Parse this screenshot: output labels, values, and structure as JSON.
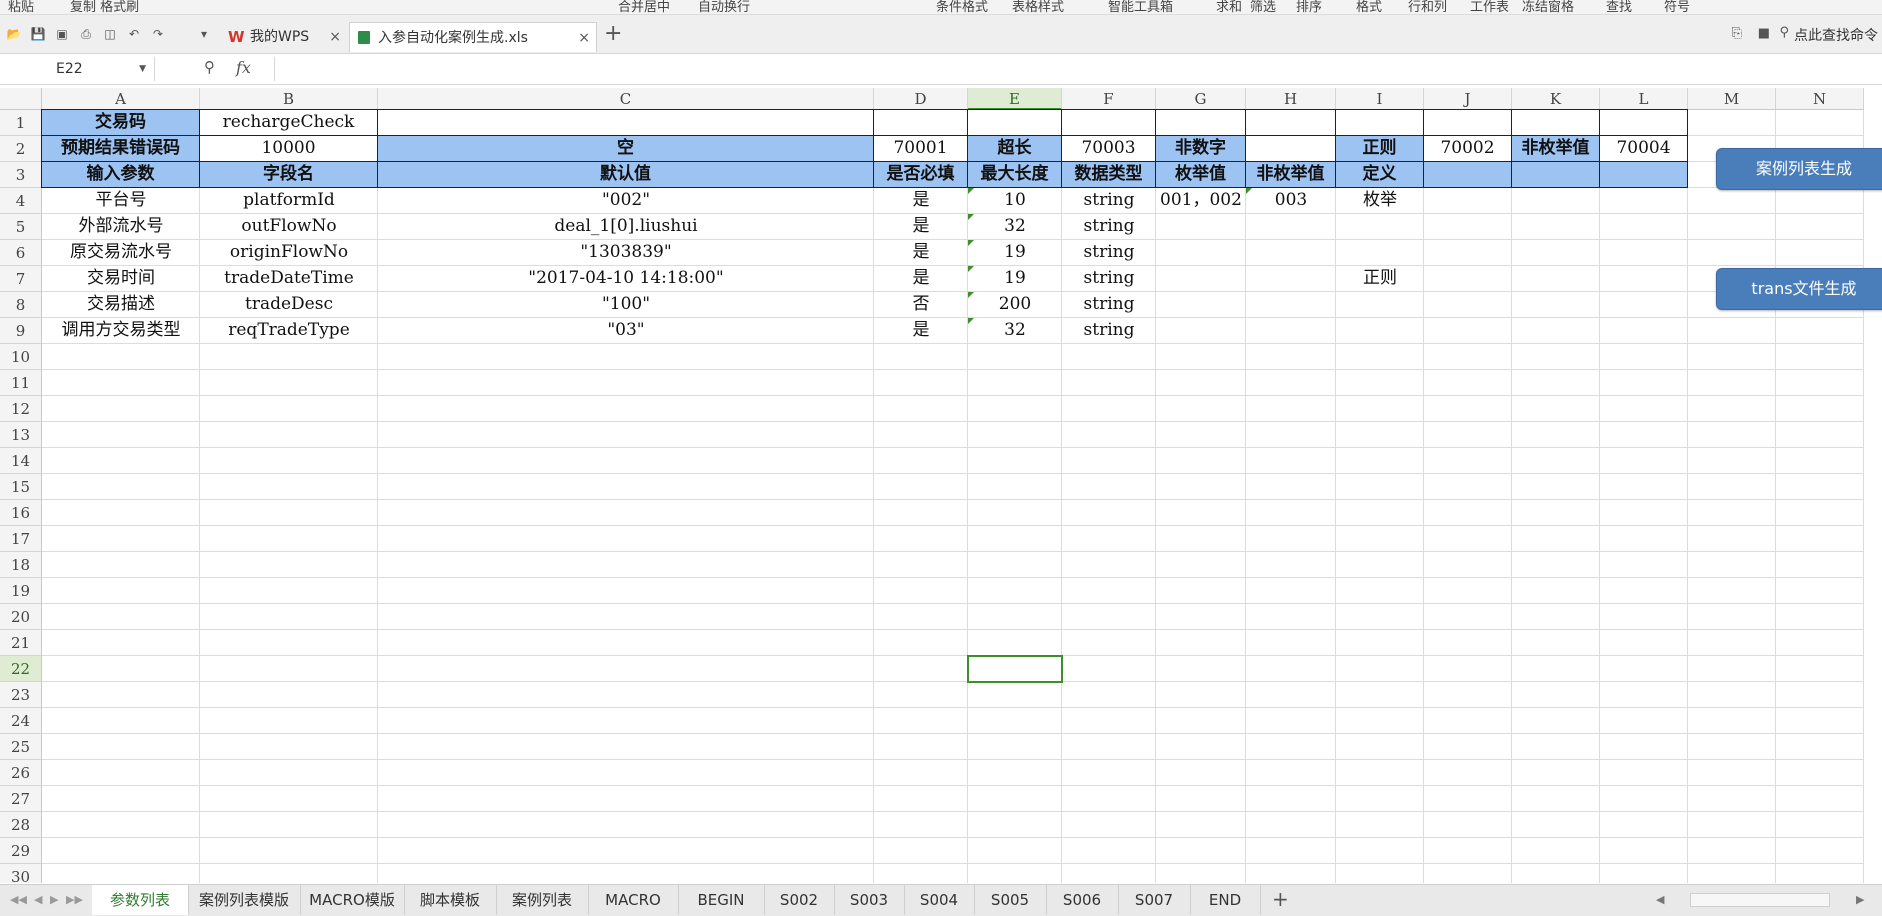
{
  "ribbon": {
    "fragments": [
      "粘贴",
      "复制 格式刷",
      "合并居中",
      "自动换行",
      "条件格式",
      "表格样式",
      "智能工具箱",
      "求和",
      "筛选",
      "排序",
      "格式",
      "行和列",
      "工作表",
      "冻结窗格",
      "查找",
      "符号"
    ]
  },
  "tabs": {
    "items": [
      {
        "label": "我的WPS",
        "active": false
      },
      {
        "label": "入参自动化案例生成.xls",
        "active": true
      }
    ],
    "add_label": "+"
  },
  "toolbar_right": {
    "search_label": "点此查找命令"
  },
  "formula_bar": {
    "cell_ref": "E22",
    "fx_label": "fx",
    "formula": ""
  },
  "columns": [
    "A",
    "B",
    "C",
    "D",
    "E",
    "F",
    "G",
    "H",
    "I",
    "J",
    "K",
    "L",
    "M",
    "N"
  ],
  "selected_column": "E",
  "row_numbers": [
    "1",
    "2",
    "3",
    "4",
    "5",
    "6",
    "7",
    "8",
    "9",
    "10",
    "11",
    "12",
    "13",
    "14",
    "15",
    "16",
    "17",
    "18",
    "19",
    "20",
    "21",
    "22",
    "23",
    "24",
    "25",
    "26",
    "27",
    "28",
    "29",
    "30"
  ],
  "selected_row": "22",
  "cells": [
    {
      "text": "交易码",
      "col": 0,
      "row": 0,
      "style": "blue"
    },
    {
      "text": "rechargeCheck",
      "col": 1,
      "row": 0,
      "style": "bordered"
    },
    {
      "text": "",
      "col": 2,
      "row": 0,
      "style": "bordered"
    },
    {
      "text": "",
      "col": 3,
      "row": 0,
      "style": "bordered"
    },
    {
      "text": "",
      "col": 4,
      "row": 0,
      "style": "bordered"
    },
    {
      "text": "",
      "col": 5,
      "row": 0,
      "style": "bordered"
    },
    {
      "text": "",
      "col": 6,
      "row": 0,
      "style": "bordered"
    },
    {
      "text": "",
      "col": 7,
      "row": 0,
      "style": "bordered"
    },
    {
      "text": "",
      "col": 8,
      "row": 0,
      "style": "bordered"
    },
    {
      "text": "",
      "col": 9,
      "row": 0,
      "style": "bordered"
    },
    {
      "text": "",
      "col": 10,
      "row": 0,
      "style": "bordered"
    },
    {
      "text": "",
      "col": 11,
      "row": 0,
      "style": "bordered"
    },
    {
      "text": "预期结果错误码",
      "col": 0,
      "row": 1,
      "style": "blue"
    },
    {
      "text": "10000",
      "col": 1,
      "row": 1,
      "style": "bordered"
    },
    {
      "text": "空",
      "col": 2,
      "row": 1,
      "style": "blue"
    },
    {
      "text": "70001",
      "col": 3,
      "row": 1,
      "style": "bordered"
    },
    {
      "text": "超长",
      "col": 4,
      "row": 1,
      "style": "blue"
    },
    {
      "text": "70003",
      "col": 5,
      "row": 1,
      "style": "bordered"
    },
    {
      "text": "非数字",
      "col": 6,
      "row": 1,
      "style": "blue"
    },
    {
      "text": "",
      "col": 7,
      "row": 1,
      "style": "bordered"
    },
    {
      "text": "正则",
      "col": 8,
      "row": 1,
      "style": "blue"
    },
    {
      "text": "70002",
      "col": 9,
      "row": 1,
      "style": "bordered"
    },
    {
      "text": "非枚举值",
      "col": 10,
      "row": 1,
      "style": "blue"
    },
    {
      "text": "70004",
      "col": 11,
      "row": 1,
      "style": "bordered"
    },
    {
      "text": "输入参数",
      "col": 0,
      "row": 2,
      "style": "blue"
    },
    {
      "text": "字段名",
      "col": 1,
      "row": 2,
      "style": "blue"
    },
    {
      "text": "默认值",
      "col": 2,
      "row": 2,
      "style": "blue"
    },
    {
      "text": "是否必填",
      "col": 3,
      "row": 2,
      "style": "blue"
    },
    {
      "text": "最大长度",
      "col": 4,
      "row": 2,
      "style": "blue"
    },
    {
      "text": "数据类型",
      "col": 5,
      "row": 2,
      "style": "blue"
    },
    {
      "text": "枚举值",
      "col": 6,
      "row": 2,
      "style": "blue"
    },
    {
      "text": "非枚举值",
      "col": 7,
      "row": 2,
      "style": "blue"
    },
    {
      "text": "定义",
      "col": 8,
      "row": 2,
      "style": "blue"
    },
    {
      "text": "",
      "col": 9,
      "row": 2,
      "style": "blue"
    },
    {
      "text": "",
      "col": 10,
      "row": 2,
      "style": "blue"
    },
    {
      "text": "",
      "col": 11,
      "row": 2,
      "style": "blue"
    },
    {
      "text": "平台号",
      "col": 0,
      "row": 3,
      "style": "plain"
    },
    {
      "text": "platformId",
      "col": 1,
      "row": 3,
      "style": "plain"
    },
    {
      "text": "\"002\"",
      "col": 2,
      "row": 3,
      "style": "plain"
    },
    {
      "text": "是",
      "col": 3,
      "row": 3,
      "style": "plain"
    },
    {
      "text": "10",
      "col": 4,
      "row": 3,
      "style": "tri"
    },
    {
      "text": "string",
      "col": 5,
      "row": 3,
      "style": "plain"
    },
    {
      "text": "001，002",
      "col": 6,
      "row": 3,
      "style": "plain"
    },
    {
      "text": "003",
      "col": 7,
      "row": 3,
      "style": "tri"
    },
    {
      "text": "枚举",
      "col": 8,
      "row": 3,
      "style": "plain"
    },
    {
      "text": "外部流水号",
      "col": 0,
      "row": 4,
      "style": "plain"
    },
    {
      "text": "outFlowNo",
      "col": 1,
      "row": 4,
      "style": "plain"
    },
    {
      "text": "deal_1[0].liushui",
      "col": 2,
      "row": 4,
      "style": "plain"
    },
    {
      "text": "是",
      "col": 3,
      "row": 4,
      "style": "plain"
    },
    {
      "text": "32",
      "col": 4,
      "row": 4,
      "style": "tri"
    },
    {
      "text": "string",
      "col": 5,
      "row": 4,
      "style": "plain"
    },
    {
      "text": "原交易流水号",
      "col": 0,
      "row": 5,
      "style": "plain"
    },
    {
      "text": "originFlowNo",
      "col": 1,
      "row": 5,
      "style": "plain"
    },
    {
      "text": "\"1303839\"",
      "col": 2,
      "row": 5,
      "style": "plain"
    },
    {
      "text": "是",
      "col": 3,
      "row": 5,
      "style": "plain"
    },
    {
      "text": "19",
      "col": 4,
      "row": 5,
      "style": "tri"
    },
    {
      "text": "string",
      "col": 5,
      "row": 5,
      "style": "plain"
    },
    {
      "text": "交易时间",
      "col": 0,
      "row": 6,
      "style": "plain"
    },
    {
      "text": "tradeDateTime",
      "col": 1,
      "row": 6,
      "style": "plain"
    },
    {
      "text": "\"2017-04-10 14:18:00\"",
      "col": 2,
      "row": 6,
      "style": "plain"
    },
    {
      "text": "是",
      "col": 3,
      "row": 6,
      "style": "plain"
    },
    {
      "text": "19",
      "col": 4,
      "row": 6,
      "style": "tri"
    },
    {
      "text": "string",
      "col": 5,
      "row": 6,
      "style": "plain"
    },
    {
      "text": "正则",
      "col": 8,
      "row": 6,
      "style": "plain"
    },
    {
      "text": "交易描述",
      "col": 0,
      "row": 7,
      "style": "plain"
    },
    {
      "text": "tradeDesc",
      "col": 1,
      "row": 7,
      "style": "plain"
    },
    {
      "text": "\"100\"",
      "col": 2,
      "row": 7,
      "style": "plain"
    },
    {
      "text": "否",
      "col": 3,
      "row": 7,
      "style": "plain"
    },
    {
      "text": "200",
      "col": 4,
      "row": 7,
      "style": "tri"
    },
    {
      "text": "string",
      "col": 5,
      "row": 7,
      "style": "plain"
    },
    {
      "text": "调用方交易类型",
      "col": 0,
      "row": 8,
      "style": "plain"
    },
    {
      "text": "reqTradeType",
      "col": 1,
      "row": 8,
      "style": "plain"
    },
    {
      "text": "\"03\"",
      "col": 2,
      "row": 8,
      "style": "plain"
    },
    {
      "text": "是",
      "col": 3,
      "row": 8,
      "style": "plain"
    },
    {
      "text": "32",
      "col": 4,
      "row": 8,
      "style": "tri"
    },
    {
      "text": "string",
      "col": 5,
      "row": 8,
      "style": "plain"
    }
  ],
  "buttons": {
    "generate_case_list": "案例列表生成",
    "generate_trans_file": "trans文件生成"
  },
  "sheet_tabs": [
    {
      "label": "参数列表",
      "active": true
    },
    {
      "label": "案例列表模版",
      "active": false
    },
    {
      "label": "MACRO模版",
      "active": false
    },
    {
      "label": "脚本模板",
      "active": false
    },
    {
      "label": "案例列表",
      "active": false
    },
    {
      "label": "MACRO",
      "active": false
    },
    {
      "label": "BEGIN",
      "active": false
    },
    {
      "label": "S002",
      "active": false
    },
    {
      "label": "S003",
      "active": false
    },
    {
      "label": "S004",
      "active": false
    },
    {
      "label": "S005",
      "active": false
    },
    {
      "label": "S006",
      "active": false
    },
    {
      "label": "S007",
      "active": false
    },
    {
      "label": "END",
      "active": false
    }
  ],
  "sheet_add_label": "+",
  "colors": {
    "header_blue": "#9dc3f2",
    "select_green": "#3d8f2a",
    "button_blue": "#4a7ebb"
  }
}
